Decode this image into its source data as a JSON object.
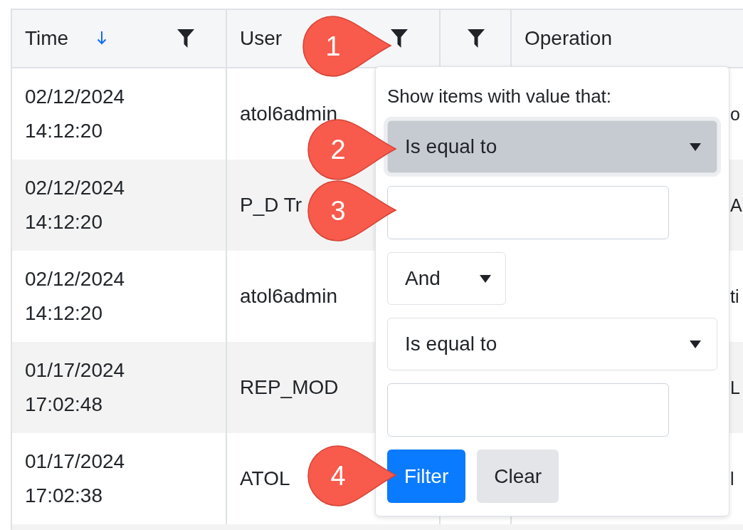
{
  "table": {
    "columns": [
      {
        "label": "Time",
        "sort_descending": true,
        "filter": true
      },
      {
        "label": "User",
        "filter": true
      },
      {
        "filter": true
      },
      {
        "label": "Operation",
        "filter": false
      }
    ],
    "rows": [
      {
        "date": "02/12/2024",
        "time": "14:12:20",
        "user": "atol6admin",
        "operation": "o"
      },
      {
        "date": "02/12/2024",
        "time": "14:12:20",
        "user": "P_D Tr",
        "operation": "A"
      },
      {
        "date": "02/12/2024",
        "time": "14:12:20",
        "user": "atol6admin",
        "operation": "ti"
      },
      {
        "date": "01/17/2024",
        "time": "17:02:48",
        "user": "REP_MOD",
        "operation": "L"
      },
      {
        "date": "01/17/2024",
        "time": "17:02:38",
        "user": "ATOL",
        "operation": "l"
      }
    ]
  },
  "filter_popup": {
    "prompt": "Show items with value that:",
    "controls": [
      {
        "kind": "select",
        "value": "Is equal to",
        "focused": true
      },
      {
        "kind": "input"
      },
      {
        "kind": "logic",
        "value": "And",
        "focused": false
      },
      {
        "kind": "select",
        "value": "Is equal to",
        "focused": false
      },
      {
        "kind": "input"
      }
    ],
    "buttons": [
      {
        "label": "Filter",
        "kind": "primary"
      },
      {
        "label": "Clear",
        "kind": "secondary"
      }
    ]
  },
  "callouts": [
    {
      "number": "1"
    },
    {
      "number": "2"
    },
    {
      "number": "3"
    },
    {
      "number": "4"
    }
  ]
}
